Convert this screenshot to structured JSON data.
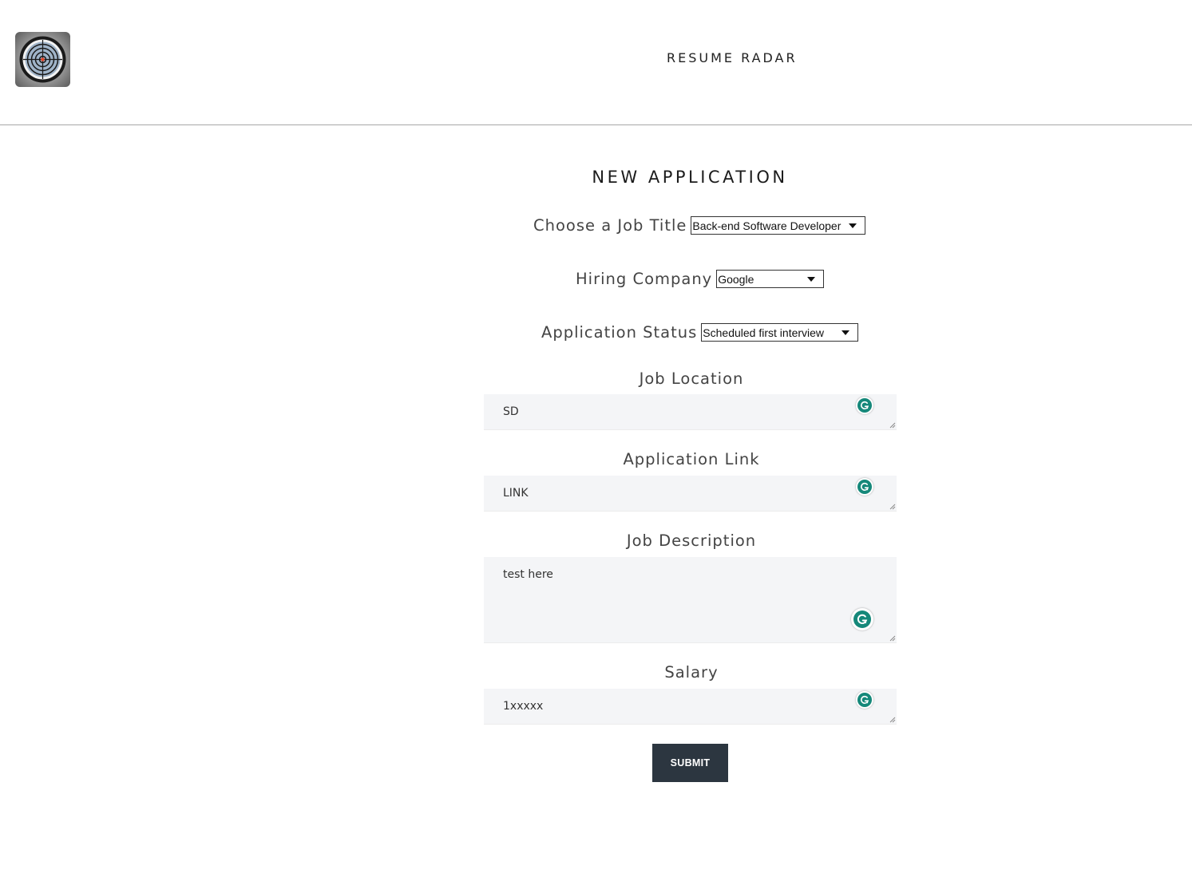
{
  "app": {
    "brand": "RESUME RADAR",
    "logo_icon": "radar-target-icon"
  },
  "form": {
    "title": "NEW APPLICATION",
    "job_title": {
      "label": "Choose a Job Title",
      "selected": "Back-end Software Developer"
    },
    "hiring_company": {
      "label": "Hiring Company",
      "selected": "Google"
    },
    "application_status": {
      "label": "Application Status",
      "selected": "Scheduled first interview"
    },
    "job_location": {
      "label": "Job Location",
      "value": "SD"
    },
    "application_link": {
      "label": "Application Link",
      "value": "LINK"
    },
    "job_description": {
      "label": "Job Description",
      "value": "test here"
    },
    "salary": {
      "label": "Salary",
      "value": "1xxxxx"
    },
    "submit_label": "SUBMIT"
  },
  "colors": {
    "submit_bg": "#2c3640",
    "field_bg": "#f4f5f7",
    "grammarly_green": "#15887a"
  }
}
